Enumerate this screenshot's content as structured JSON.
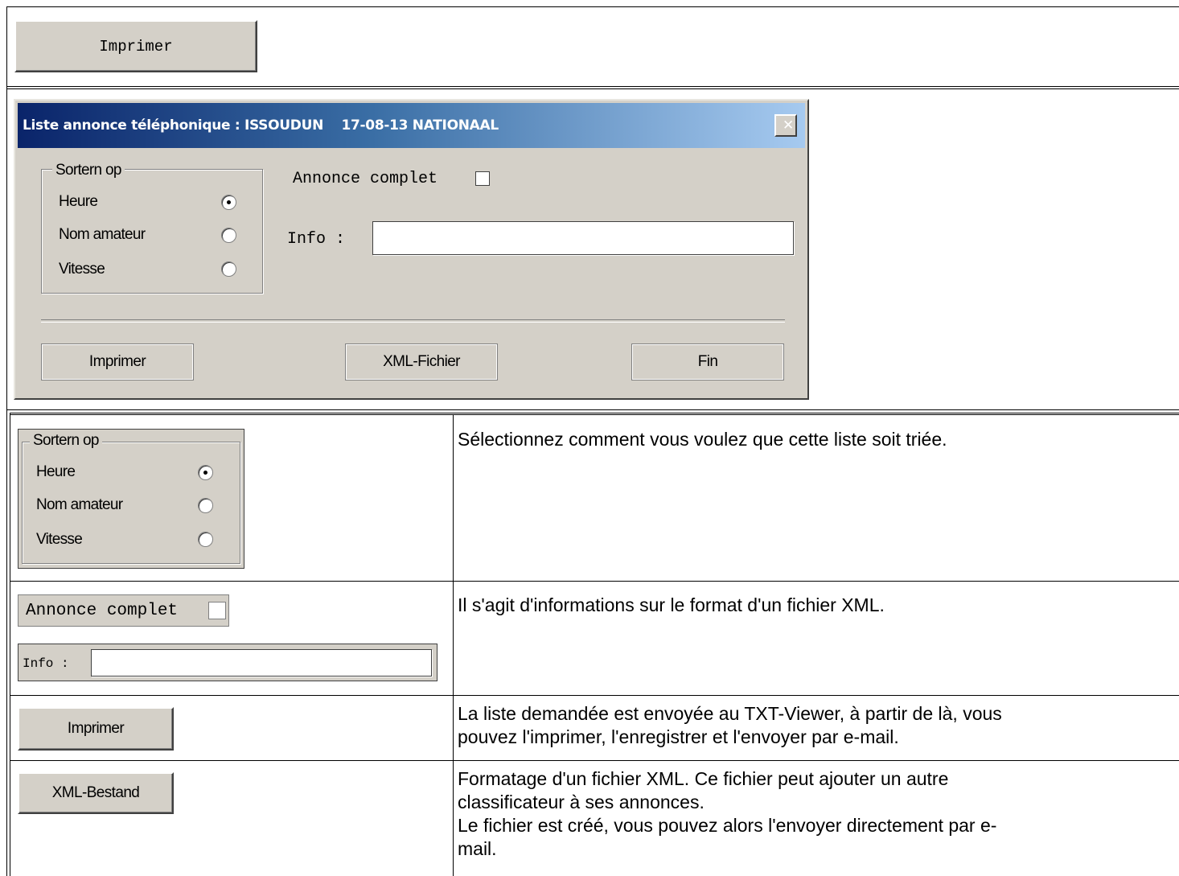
{
  "top": {
    "print_label": "Imprimer"
  },
  "dialog": {
    "title": "Liste annonce téléphonique : ISSOUDUN    17-08-13 NATIONAAL",
    "close_glyph": "✕",
    "sort_group": {
      "legend": "Sortern op",
      "options": [
        "Heure",
        "Nom amateur",
        "Vitesse"
      ],
      "selected": "Heure"
    },
    "annonce_label": "Annonce complet",
    "annonce_checked": false,
    "info_label": "Info :",
    "info_value": "",
    "buttons": {
      "print": "Imprimer",
      "xml": "XML-Fichier",
      "end": "Fin"
    }
  },
  "rows": [
    {
      "sort_group": {
        "legend": "Sortern op",
        "options": [
          "Heure",
          "Nom amateur",
          "Vitesse"
        ]
      },
      "description": "Sélectionnez comment vous voulez que cette liste soit triée."
    },
    {
      "annonce_label": "Annonce complet",
      "info_label": "Info :",
      "description": "Il s'agit d'informations sur le format d'un fichier XML."
    },
    {
      "button": "Imprimer",
      "description_lines": [
        "La liste demandée est envoyée au TXT-Viewer, à partir de là, vous",
        "pouvez l'imprimer, l'enregistrer et l'envoyer par e-mail."
      ]
    },
    {
      "button": "XML-Bestand",
      "description_lines": [
        "Formatage d'un fichier XML. Ce fichier peut ajouter un autre",
        "classificateur à ses annonces.",
        "Le fichier est créé, vous pouvez alors l'envoyer directement par e-",
        "mail."
      ]
    }
  ]
}
